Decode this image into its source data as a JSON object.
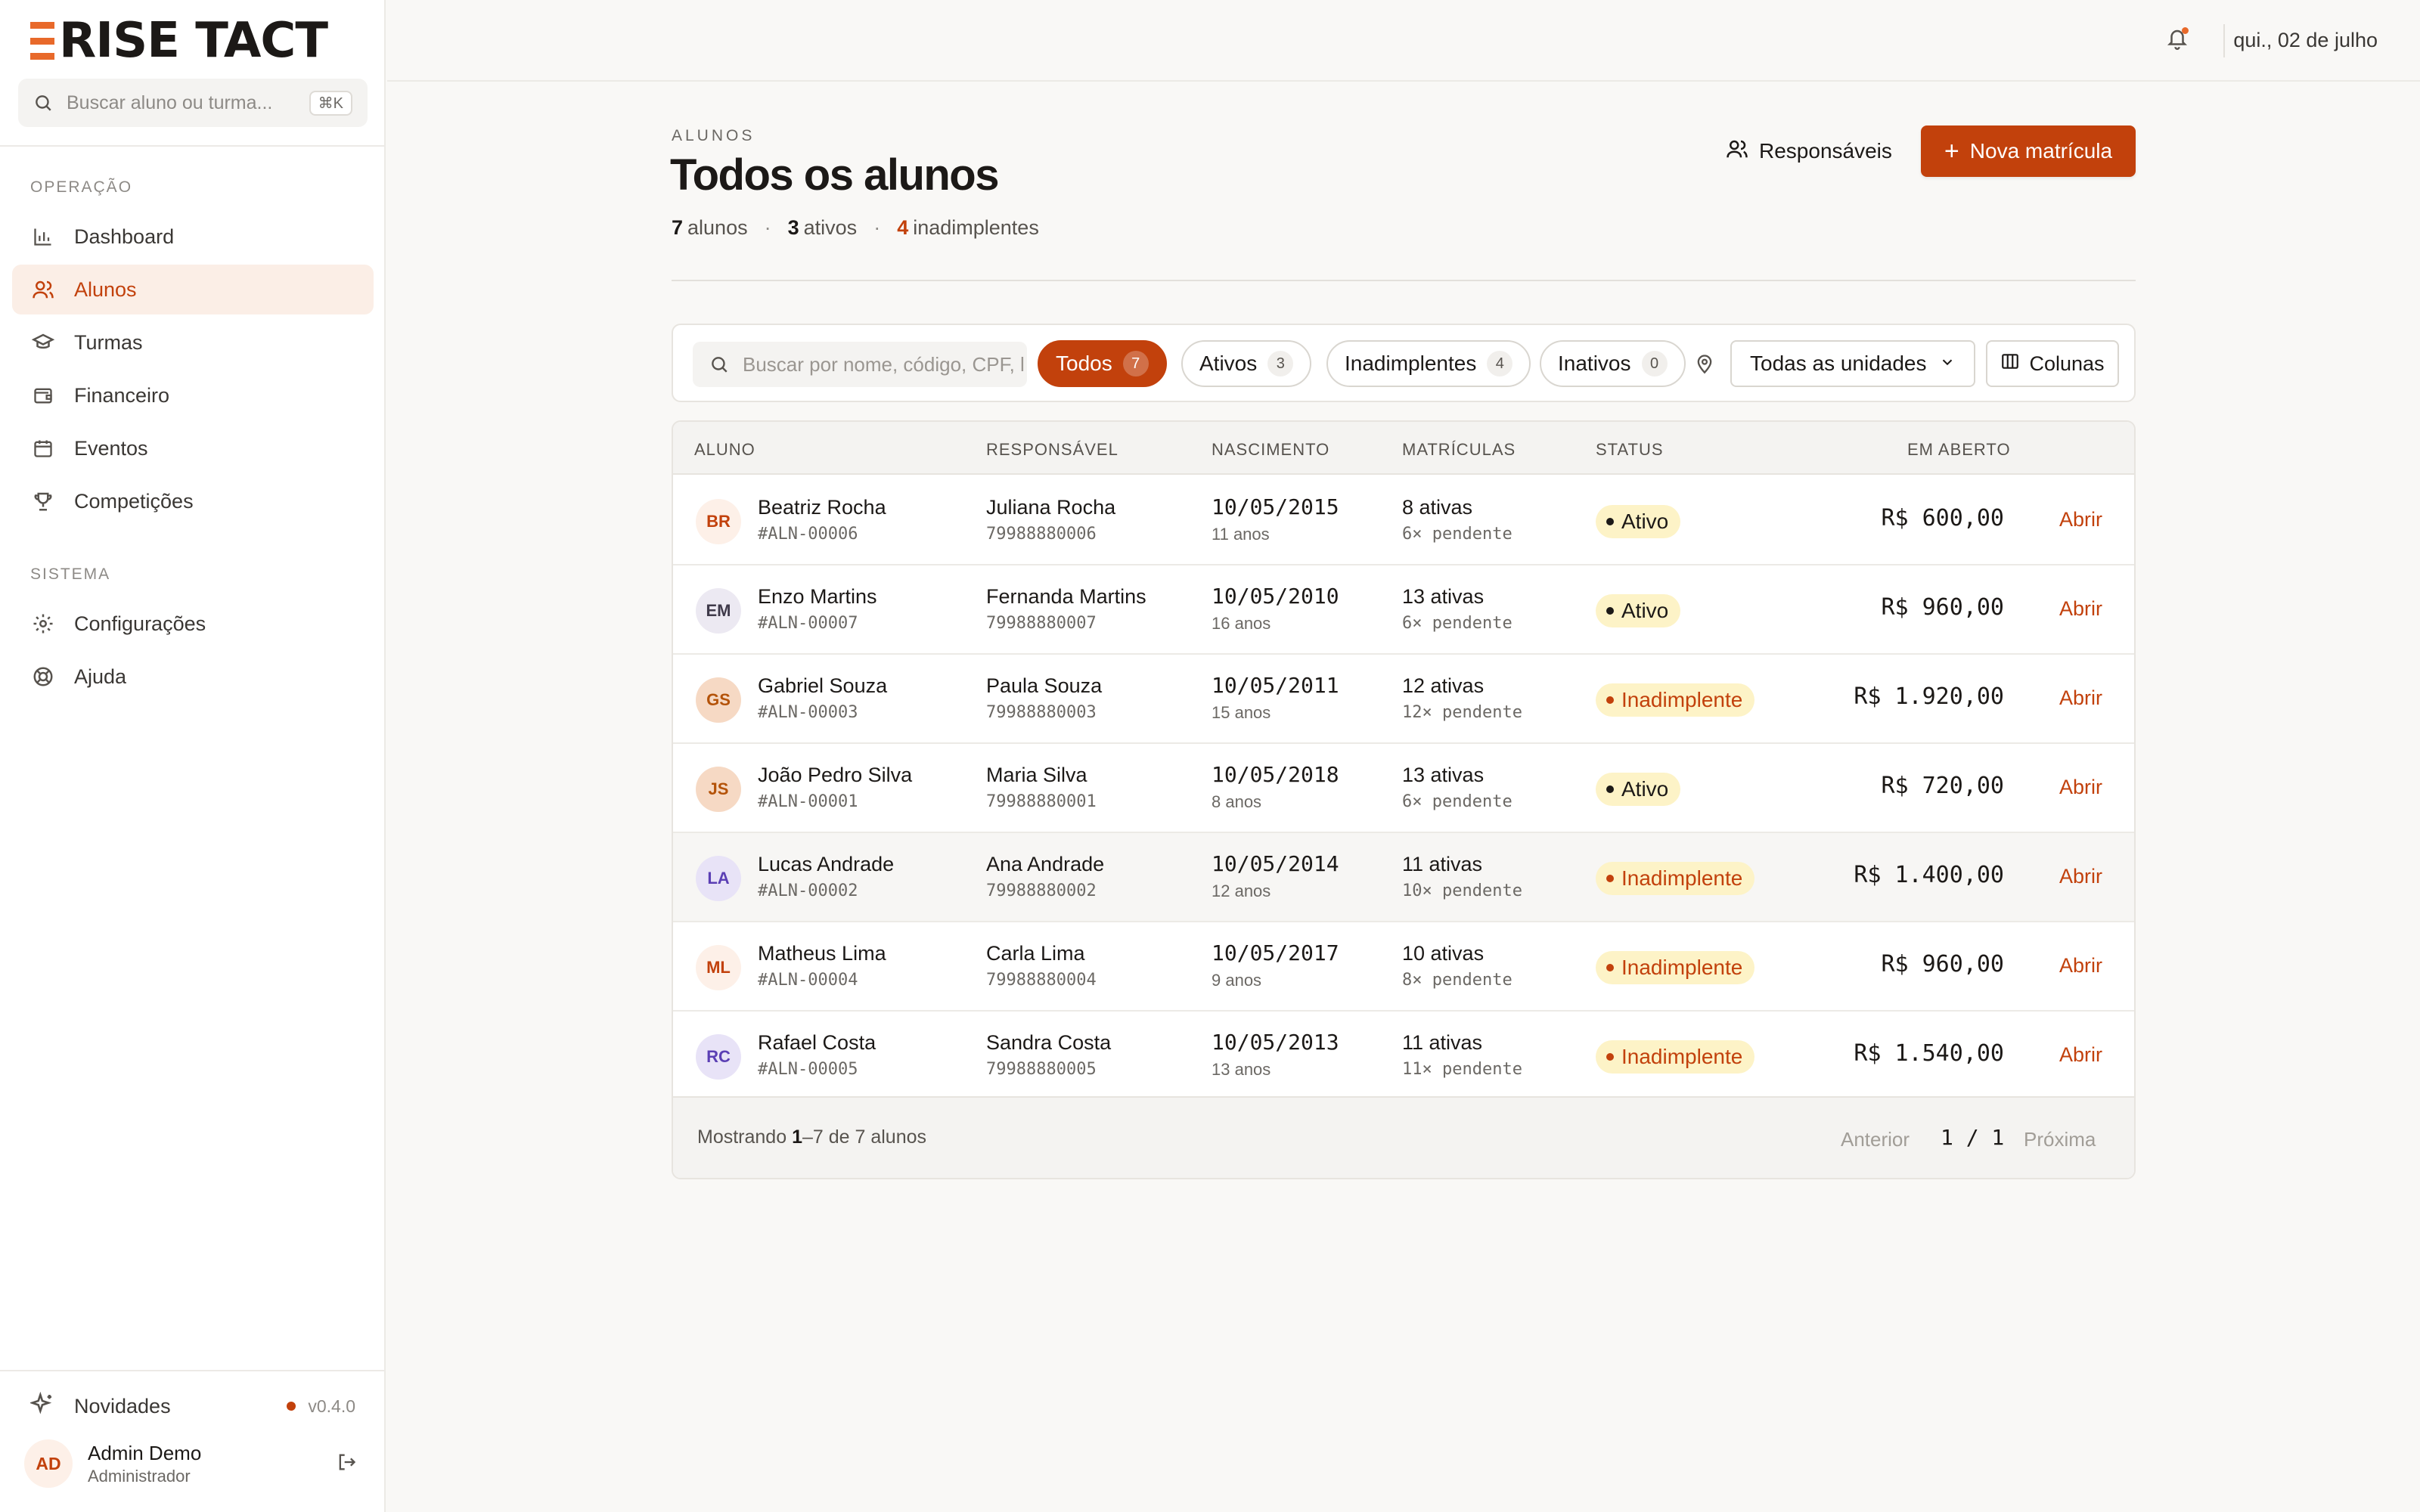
{
  "brand": {
    "name": "RISE TACT",
    "accent": "#c2410c",
    "logo_color": "#e8692a"
  },
  "sidebar": {
    "search_placeholder": "Buscar aluno ou turma...",
    "search_shortcut": "⌘K",
    "sections": [
      {
        "label": "OPERAÇÃO"
      },
      {
        "label": "SISTEMA"
      }
    ],
    "items": [
      {
        "label": "Dashboard",
        "icon": "bar-chart-icon",
        "active": false
      },
      {
        "label": "Alunos",
        "icon": "users-icon",
        "active": true
      },
      {
        "label": "Turmas",
        "icon": "graduation-cap-icon",
        "active": false
      },
      {
        "label": "Financeiro",
        "icon": "wallet-icon",
        "active": false
      },
      {
        "label": "Eventos",
        "icon": "calendar-icon",
        "active": false
      },
      {
        "label": "Competições",
        "icon": "trophy-icon",
        "active": false
      },
      {
        "label": "Configurações",
        "icon": "gear-icon",
        "active": false
      },
      {
        "label": "Ajuda",
        "icon": "lifebuoy-icon",
        "active": false
      }
    ],
    "news": {
      "label": "Novidades",
      "version": "v0.4.0"
    },
    "user": {
      "initials": "AD",
      "name": "Admin Demo",
      "role": "Administrador"
    }
  },
  "topbar": {
    "date": "qui., 02 de julho"
  },
  "page": {
    "eyebrow": "ALUNOS",
    "title": "Todos os alunos",
    "summary": {
      "total": "7",
      "total_label": "alunos",
      "active": "3",
      "active_label": "ativos",
      "overdue": "4",
      "overdue_label": "inadimplentes",
      "separator": "·"
    },
    "guardians_button": "Responsáveis",
    "new_button": "Nova matrícula"
  },
  "filters": {
    "search_placeholder": "Buscar por nome, código, CPF, l",
    "chips": [
      {
        "label": "Todos",
        "count": "7",
        "active": true
      },
      {
        "label": "Ativos",
        "count": "3",
        "active": false
      },
      {
        "label": "Inadimplentes",
        "count": "4",
        "active": false
      },
      {
        "label": "Inativos",
        "count": "0",
        "active": false
      }
    ],
    "unit_select": "Todas as unidades",
    "columns_button": "Colunas"
  },
  "table": {
    "headers": [
      "ALUNO",
      "RESPONSÁVEL",
      "NASCIMENTO",
      "MATRÍCULAS",
      "STATUS",
      "EM ABERTO"
    ],
    "open_label": "Abrir",
    "rows": [
      {
        "initials": "BR",
        "name": "Beatriz Rocha",
        "code": "#ALN-00006",
        "guardian": "Juliana Rocha",
        "phone": "79988880006",
        "birth": "10/05/2015",
        "age": "11 anos",
        "enrollments": "8 ativas",
        "pending": "6× pendente",
        "status": "Ativo",
        "status_type": "ok",
        "amount": "R$ 600,00",
        "avatar_bg": "#fdf0e8",
        "avatar_fg": "#c2410c"
      },
      {
        "initials": "EM",
        "name": "Enzo Martins",
        "code": "#ALN-00007",
        "guardian": "Fernanda Martins",
        "phone": "79988880007",
        "birth": "10/05/2010",
        "age": "16 anos",
        "enrollments": "13 ativas",
        "pending": "6× pendente",
        "status": "Ativo",
        "status_type": "ok",
        "amount": "R$ 960,00",
        "avatar_bg": "#ece9f2",
        "avatar_fg": "#3f3a4a"
      },
      {
        "initials": "GS",
        "name": "Gabriel Souza",
        "code": "#ALN-00003",
        "guardian": "Paula Souza",
        "phone": "79988880003",
        "birth": "10/05/2011",
        "age": "15 anos",
        "enrollments": "12 ativas",
        "pending": "12× pendente",
        "status": "Inadimplente",
        "status_type": "late",
        "amount": "R$ 1.920,00",
        "avatar_bg": "#f6d9c4",
        "avatar_fg": "#b45309"
      },
      {
        "initials": "JS",
        "name": "João Pedro Silva",
        "code": "#ALN-00001",
        "guardian": "Maria Silva",
        "phone": "79988880001",
        "birth": "10/05/2018",
        "age": "8 anos",
        "enrollments": "13 ativas",
        "pending": "6× pendente",
        "status": "Ativo",
        "status_type": "ok",
        "amount": "R$ 720,00",
        "avatar_bg": "#f6d9c4",
        "avatar_fg": "#b45309"
      },
      {
        "initials": "LA",
        "name": "Lucas Andrade",
        "code": "#ALN-00002",
        "guardian": "Ana Andrade",
        "phone": "79988880002",
        "birth": "10/05/2014",
        "age": "12 anos",
        "enrollments": "11 ativas",
        "pending": "10× pendente",
        "status": "Inadimplente",
        "status_type": "late",
        "amount": "R$ 1.400,00",
        "avatar_bg": "#e8e3f7",
        "avatar_fg": "#5b3fb4"
      },
      {
        "initials": "ML",
        "name": "Matheus Lima",
        "code": "#ALN-00004",
        "guardian": "Carla Lima",
        "phone": "79988880004",
        "birth": "10/05/2017",
        "age": "9 anos",
        "enrollments": "10 ativas",
        "pending": "8× pendente",
        "status": "Inadimplente",
        "status_type": "late",
        "amount": "R$ 960,00",
        "avatar_bg": "#fdf0e8",
        "avatar_fg": "#c2410c"
      },
      {
        "initials": "RC",
        "name": "Rafael Costa",
        "code": "#ALN-00005",
        "guardian": "Sandra Costa",
        "phone": "79988880005",
        "birth": "10/05/2013",
        "age": "13 anos",
        "enrollments": "11 ativas",
        "pending": "11× pendente",
        "status": "Inadimplente",
        "status_type": "late",
        "amount": "R$ 1.540,00",
        "avatar_bg": "#e8e3f7",
        "avatar_fg": "#5b3fb4"
      }
    ],
    "footer": {
      "showing_prefix": "Mostrando",
      "showing_range": "1",
      "showing_suffix": "–7 de 7 alunos",
      "prev": "Anterior",
      "pages": "1 / 1",
      "next": "Próxima"
    }
  }
}
